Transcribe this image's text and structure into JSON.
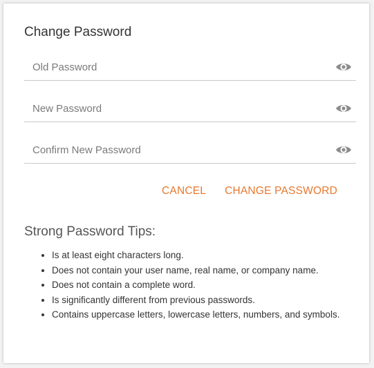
{
  "form": {
    "title": "Change Password",
    "fields": [
      {
        "placeholder": "Old Password",
        "value": "",
        "icon": "eye-icon"
      },
      {
        "placeholder": "New Password",
        "value": "",
        "icon": "eye-icon"
      },
      {
        "placeholder": "Confirm New Password",
        "value": "",
        "icon": "eye-icon"
      }
    ],
    "cancel_label": "CANCEL",
    "submit_label": "CHANGE PASSWORD"
  },
  "tips": {
    "title": "Strong Password Tips:",
    "items": [
      "Is at least eight characters long.",
      "Does not contain your user name, real name, or company name.",
      "Does not contain a complete word.",
      "Is significantly different from previous passwords.",
      "Contains uppercase letters, lowercase letters, numbers, and symbols."
    ]
  },
  "colors": {
    "accent": "#e8782f",
    "icon": "#8c8c8c",
    "divider": "#c9c9c9"
  }
}
